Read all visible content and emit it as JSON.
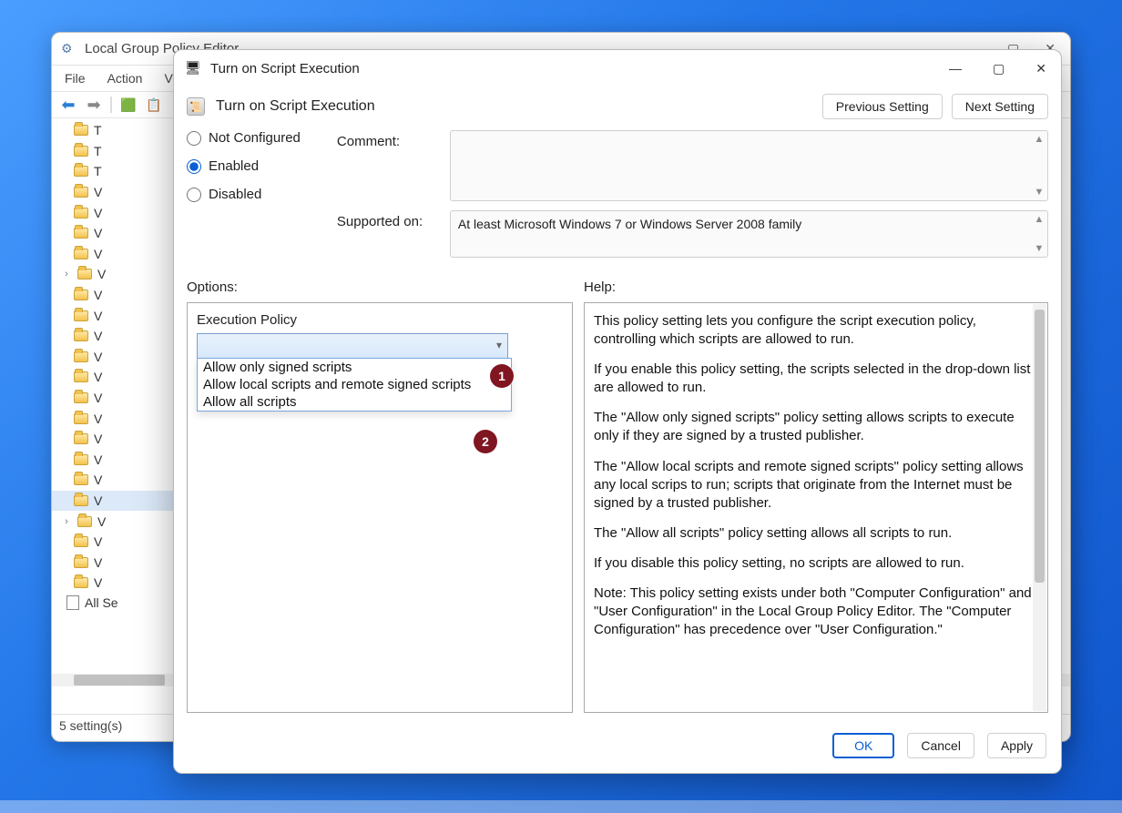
{
  "bg": {
    "title": "Local Group Policy Editor",
    "menu": {
      "file": "File",
      "action": "Action",
      "view": "Vie"
    },
    "status": "5 setting(s)",
    "all_settings": "All Se",
    "tree_items": [
      "T",
      "T",
      "T",
      "V",
      "V",
      "V",
      "V",
      "V",
      "V",
      "V",
      "V",
      "V",
      "V",
      "V",
      "V",
      "V",
      "V",
      "V",
      "V",
      "V",
      "V",
      "V",
      "V"
    ]
  },
  "dlg": {
    "title": "Turn on Script Execution",
    "header": "Turn on Script Execution",
    "prev": "Previous Setting",
    "next": "Next Setting",
    "state": {
      "not_configured": "Not Configured",
      "enabled": "Enabled",
      "disabled": "Disabled"
    },
    "comment_label": "Comment:",
    "comment_value": "",
    "supported_label": "Supported on:",
    "supported_value": "At least Microsoft Windows 7 or Windows Server 2008 family",
    "options_label": "Options:",
    "help_label": "Help:",
    "exec_policy_label": "Execution Policy",
    "combo_value": "",
    "dropdown": {
      "opt1": "Allow only signed scripts",
      "opt2": "Allow local scripts and remote signed scripts",
      "opt3": "Allow all scripts"
    },
    "help": {
      "p1": "This policy setting lets you configure the script execution policy, controlling which scripts are allowed to run.",
      "p2": "If you enable this policy setting, the scripts selected in the drop-down list are allowed to run.",
      "p3": "The \"Allow only signed scripts\" policy setting allows scripts to execute only if they are signed by a trusted publisher.",
      "p4": "The \"Allow local scripts and remote signed scripts\" policy setting allows any local scrips to run; scripts that originate from the Internet must be signed by a trusted publisher.",
      "p5": "The \"Allow all scripts\" policy setting allows all scripts to run.",
      "p6": "If you disable this policy setting, no scripts are allowed to run.",
      "p7": "Note: This policy setting exists under both \"Computer Configuration\" and \"User Configuration\" in the Local Group Policy Editor. The \"Computer Configuration\" has precedence over \"User Configuration.\""
    },
    "footer": {
      "ok": "OK",
      "cancel": "Cancel",
      "apply": "Apply"
    }
  },
  "callouts": {
    "c1": "1",
    "c2": "2"
  }
}
